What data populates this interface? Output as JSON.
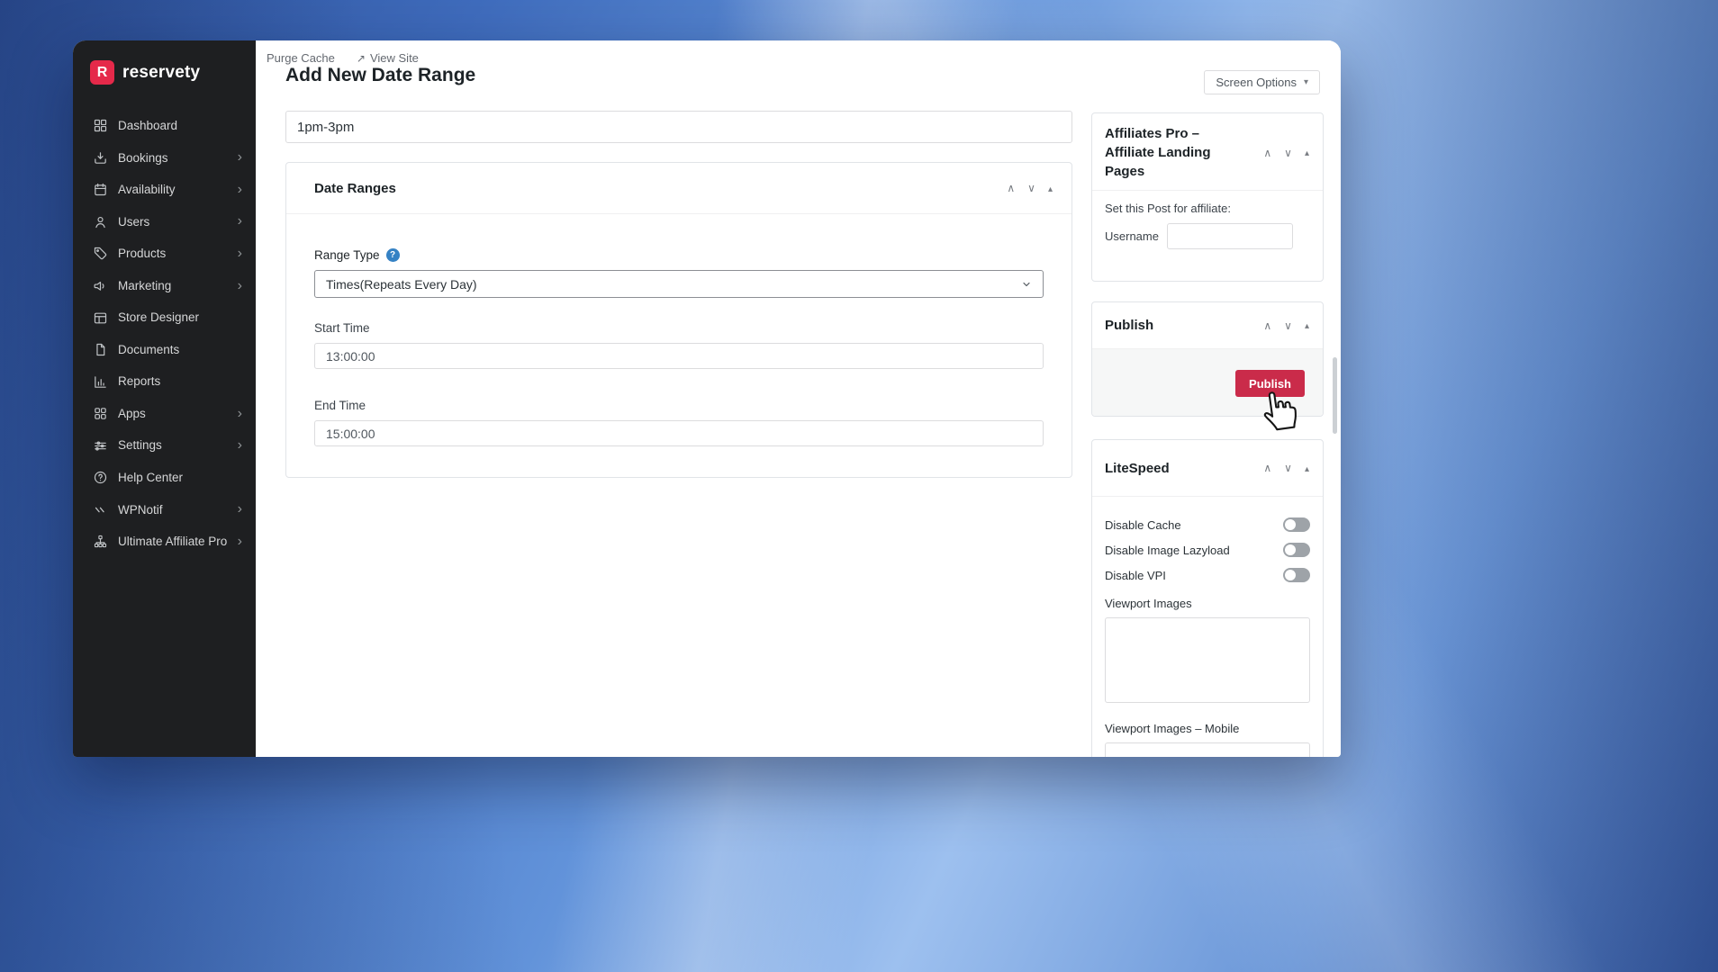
{
  "window": {
    "topbar": {
      "purge_cache": "Purge Cache",
      "view_site": "View Site"
    },
    "page_title": "Add New Date Range",
    "screen_options": {
      "label": "Screen Options"
    }
  },
  "icons": {
    "external_link": "↗",
    "caret_down": "▾",
    "question": "?",
    "collapse": "▴",
    "chevron_up": "∧",
    "chevron_down": "∨",
    "chevron_right": "›"
  },
  "sidebar": {
    "logo_letter": "R",
    "logo_text": "reservety",
    "items": [
      {
        "label": "Dashboard",
        "icon": "dashboard-icon",
        "has_submenu": false
      },
      {
        "label": "Bookings",
        "icon": "bookings-icon",
        "has_submenu": true
      },
      {
        "label": "Availability",
        "icon": "calendar-icon",
        "has_submenu": true
      },
      {
        "label": "Users",
        "icon": "user-icon",
        "has_submenu": true
      },
      {
        "label": "Products",
        "icon": "tag-icon",
        "has_submenu": true
      },
      {
        "label": "Marketing",
        "icon": "megaphone-icon",
        "has_submenu": true
      },
      {
        "label": "Store Designer",
        "icon": "layout-icon",
        "has_submenu": false
      },
      {
        "label": "Documents",
        "icon": "file-icon",
        "has_submenu": false
      },
      {
        "label": "Reports",
        "icon": "bar-chart-icon",
        "has_submenu": false
      },
      {
        "label": "Apps",
        "icon": "apps-grid-icon",
        "has_submenu": true
      },
      {
        "label": "Settings",
        "icon": "sliders-icon",
        "has_submenu": true
      },
      {
        "label": "Help Center",
        "icon": "help-circle-icon",
        "has_submenu": false
      },
      {
        "label": "WPNotif",
        "icon": "wpnotif-icon",
        "has_submenu": true
      },
      {
        "label": "Ultimate Affiliate Pro",
        "icon": "affiliate-network-icon",
        "has_submenu": true
      }
    ]
  },
  "editor": {
    "title_value": "1pm-3pm",
    "date_ranges": {
      "title": "Date Ranges",
      "range_type_label": "Range Type",
      "range_type_value": "Times(Repeats Every Day)",
      "start_time_label": "Start Time",
      "start_time_value": "13:00:00",
      "end_time_label": "End Time",
      "end_time_value": "15:00:00"
    }
  },
  "panels": {
    "affiliates": {
      "title": "Affiliates Pro – Affiliate Landing Pages",
      "set_post_label": "Set this Post for affiliate:",
      "username_label": "Username",
      "username_value": ""
    },
    "publish": {
      "title": "Publish",
      "button_label": "Publish"
    },
    "litespeed": {
      "title": "LiteSpeed",
      "toggles": [
        {
          "label": "Disable Cache",
          "state": "off"
        },
        {
          "label": "Disable Image Lazyload",
          "state": "off"
        },
        {
          "label": "Disable VPI",
          "state": "off"
        }
      ],
      "viewport_images_label": "Viewport Images",
      "viewport_images_value": "",
      "viewport_images_mobile_label": "Viewport Images – Mobile",
      "viewport_images_mobile_value": ""
    }
  },
  "colors": {
    "brand_red": "#e5294a",
    "publish_button": "#ca2b4a",
    "sidebar_bg": "#1e1f21",
    "help_blue": "#3582c4",
    "desktop_blue": "#6293da"
  }
}
